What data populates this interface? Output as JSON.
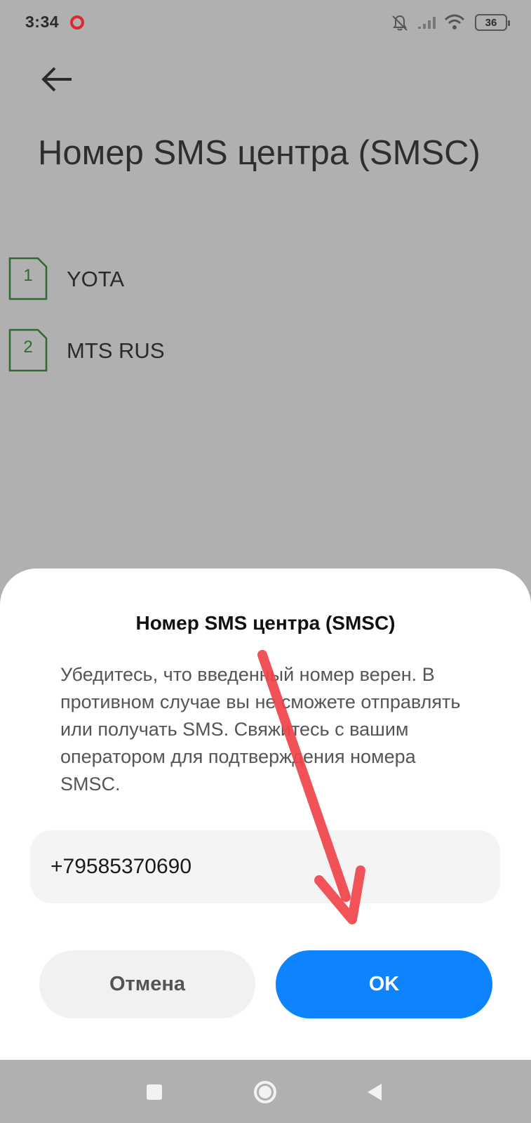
{
  "status_bar": {
    "time": "3:34",
    "battery": "36",
    "icons": [
      "opera-icon",
      "mute-icon",
      "signal-icon",
      "wifi-icon",
      "battery-icon"
    ]
  },
  "header": {
    "back_icon": "arrow-left-icon",
    "title": "Номер SMS центра (SMSC)"
  },
  "sims": [
    {
      "slot": "1",
      "label": "YOTA"
    },
    {
      "slot": "2",
      "label": "MTS RUS"
    }
  ],
  "dialog": {
    "title": "Номер SMS центра (SMSC)",
    "message": "Убедитесь, что введенный номер верен. В противном случае вы не сможете отправлять или получать SMS. Свяжитесь с вашим оператором для подтверждения номера SMSC.",
    "input_value": "+79585370690",
    "cancel_label": "Отмена",
    "ok_label": "OK"
  },
  "nav_bar": {
    "icons": [
      "recent-apps-icon",
      "home-icon",
      "back-icon"
    ]
  },
  "colors": {
    "accent": "#0d84fe",
    "sim_green": "#2e6a2e",
    "arrow": "#f0444a",
    "overlay": "#b0b0b0"
  }
}
